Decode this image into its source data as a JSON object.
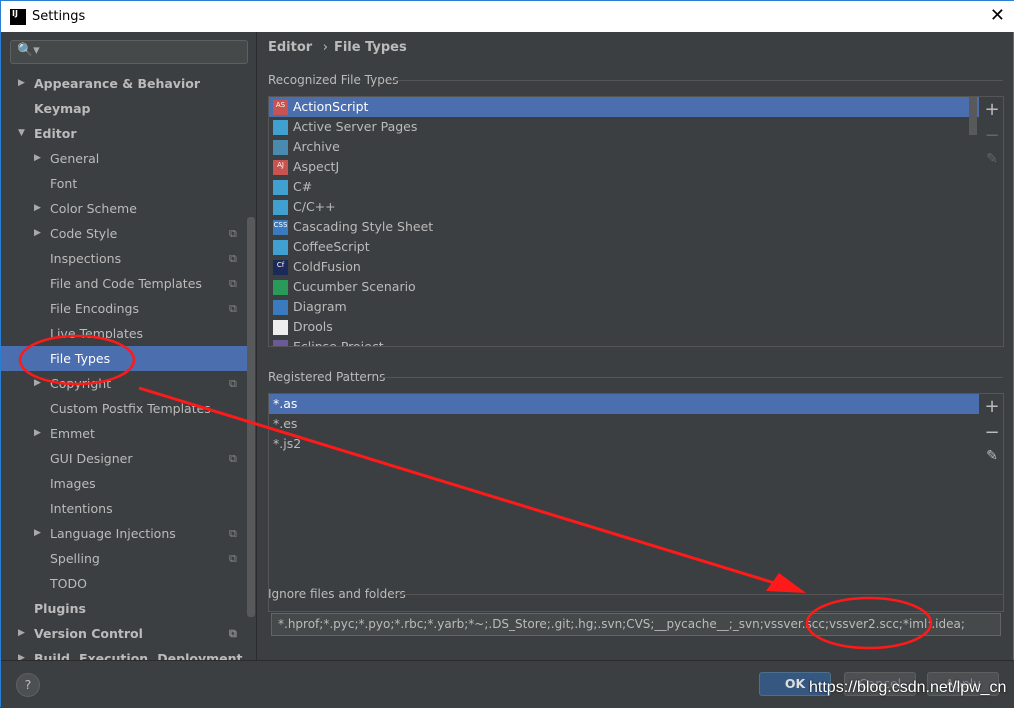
{
  "window": {
    "title": "Settings",
    "close": "✕",
    "logo": "IJ"
  },
  "search": {
    "icon": "search-icon",
    "placeholder": "",
    "glyph": "🔍▾"
  },
  "tree": [
    {
      "label": "Appearance & Behavior",
      "level": 0,
      "bold": true,
      "arrow": "▶"
    },
    {
      "label": "Keymap",
      "level": 0,
      "bold": true
    },
    {
      "label": "Editor",
      "level": 0,
      "bold": true,
      "arrow": "▼"
    },
    {
      "label": "General",
      "level": 1,
      "arrow": "▶"
    },
    {
      "label": "Font",
      "level": 1
    },
    {
      "label": "Color Scheme",
      "level": 1,
      "arrow": "▶"
    },
    {
      "label": "Code Style",
      "level": 1,
      "arrow": "▶",
      "copy": true
    },
    {
      "label": "Inspections",
      "level": 1,
      "copy": true
    },
    {
      "label": "File and Code Templates",
      "level": 1,
      "copy": true
    },
    {
      "label": "File Encodings",
      "level": 1,
      "copy": true
    },
    {
      "label": "Live Templates",
      "level": 1
    },
    {
      "label": "File Types",
      "level": 1,
      "selected": true
    },
    {
      "label": "Copyright",
      "level": 1,
      "arrow": "▶",
      "copy": true
    },
    {
      "label": "Custom Postfix Templates",
      "level": 1
    },
    {
      "label": "Emmet",
      "level": 1,
      "arrow": "▶"
    },
    {
      "label": "GUI Designer",
      "level": 1,
      "copy": true
    },
    {
      "label": "Images",
      "level": 1
    },
    {
      "label": "Intentions",
      "level": 1
    },
    {
      "label": "Language Injections",
      "level": 1,
      "arrow": "▶",
      "copy": true
    },
    {
      "label": "Spelling",
      "level": 1,
      "copy": true
    },
    {
      "label": "TODO",
      "level": 1
    },
    {
      "label": "Plugins",
      "level": 0,
      "bold": true
    },
    {
      "label": "Version Control",
      "level": 0,
      "bold": true,
      "arrow": "▶",
      "copy": true
    },
    {
      "label": "Build, Execution, Deployment",
      "level": 0,
      "bold": true,
      "arrow": "▶"
    }
  ],
  "breadcrumb": {
    "parent": "Editor",
    "sep": "›",
    "current": "File Types"
  },
  "recognized": {
    "label": "Recognized File Types",
    "items": [
      {
        "label": "ActionScript",
        "icon": "AS",
        "color": "#c75450",
        "selected": true
      },
      {
        "label": "Active Server Pages",
        "icon": "",
        "color": "#40a0d0"
      },
      {
        "label": "Archive",
        "icon": "",
        "color": "#4a8ab0"
      },
      {
        "label": "AspectJ",
        "icon": "AJ",
        "color": "#c75450"
      },
      {
        "label": "C#",
        "icon": "",
        "color": "#40a0d0"
      },
      {
        "label": "C/C++",
        "icon": "",
        "color": "#40a0d0"
      },
      {
        "label": "Cascading Style Sheet",
        "icon": "CSS",
        "color": "#3a7bbf"
      },
      {
        "label": "CoffeeScript",
        "icon": "",
        "color": "#40a0d0"
      },
      {
        "label": "ColdFusion",
        "icon": "Cf",
        "color": "#1a2a5a"
      },
      {
        "label": "Cucumber Scenario",
        "icon": "",
        "color": "#2a9a5a"
      },
      {
        "label": "Diagram",
        "icon": "",
        "color": "#3a7bbf"
      },
      {
        "label": "Drools",
        "icon": "",
        "color": "#eeeeee"
      },
      {
        "label": "Eclipse Project",
        "icon": "",
        "color": "#6a5a9a"
      }
    ]
  },
  "patterns": {
    "label": "Registered Patterns",
    "items": [
      {
        "label": "*.as",
        "selected": true
      },
      {
        "label": "*.es"
      },
      {
        "label": "*.js2"
      }
    ]
  },
  "toolbar": {
    "add": "+",
    "remove": "−",
    "edit": "✎"
  },
  "ignore": {
    "label": "Ignore files and folders",
    "value": "*.hprof;*.pyc;*.pyo;*.rbc;*.yarb;*~;.DS_Store;.git;.hg;.svn;CVS;__pycache__;_svn;vssver.scc;vssver2.scc;*iml;.idea;"
  },
  "buttons": {
    "help": "?",
    "ok": "OK",
    "cancel": "Cancel",
    "apply": "Apply"
  },
  "watermark": "https://blog.csdn.net/lpw_cn",
  "colors": {
    "selection": "#4b6eaf",
    "annotation": "#ff1a1a"
  }
}
